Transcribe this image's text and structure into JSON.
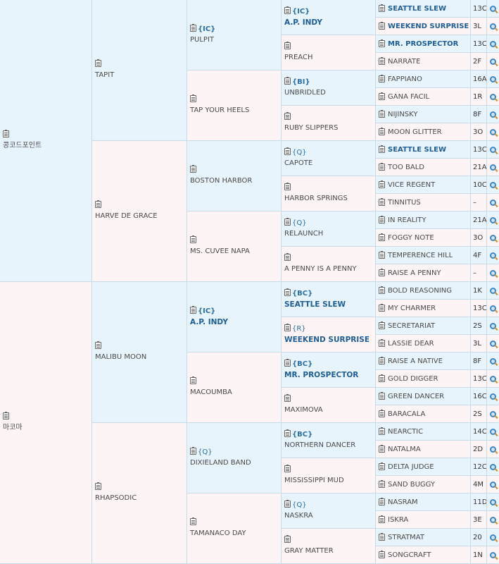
{
  "gen1": [
    {
      "name": "콩코드포인트",
      "tag": "",
      "bold": false
    },
    {
      "name": "마코마",
      "tag": "",
      "bold": false
    }
  ],
  "gen2": [
    {
      "name": "TAPIT",
      "tag": "",
      "bold": false
    },
    {
      "name": "HARVE DE GRACE",
      "tag": "",
      "bold": false
    },
    {
      "name": "MALIBU MOON",
      "tag": "",
      "bold": false
    },
    {
      "name": "RHAPSODIC",
      "tag": "",
      "bold": false
    }
  ],
  "gen3": [
    {
      "name": "PULPIT",
      "tag": "{IC}",
      "bold": false
    },
    {
      "name": "TAP YOUR HEELS",
      "tag": "",
      "bold": false
    },
    {
      "name": "BOSTON HARBOR",
      "tag": "",
      "bold": false
    },
    {
      "name": "MS. CUVEE NAPA",
      "tag": "",
      "bold": false
    },
    {
      "name": "A.P. INDY",
      "tag": "{IC}",
      "bold": true
    },
    {
      "name": "MACOUMBA",
      "tag": "",
      "bold": false
    },
    {
      "name": "DIXIELAND BAND",
      "tag": "{Q}",
      "bold": false
    },
    {
      "name": "TAMANACO DAY",
      "tag": "",
      "bold": false
    }
  ],
  "gen4": [
    {
      "name": "A.P. INDY",
      "tag": "{IC}",
      "bold": true
    },
    {
      "name": "PREACH",
      "tag": "",
      "bold": false
    },
    {
      "name": "UNBRIDLED",
      "tag": "{BI}",
      "bold": false
    },
    {
      "name": "RUBY SLIPPERS",
      "tag": "",
      "bold": false
    },
    {
      "name": "CAPOTE",
      "tag": "{Q}",
      "bold": false
    },
    {
      "name": "HARBOR SPRINGS",
      "tag": "",
      "bold": false
    },
    {
      "name": "RELAUNCH",
      "tag": "{Q}",
      "bold": false
    },
    {
      "name": "A PENNY IS A PENNY",
      "tag": "",
      "bold": false
    },
    {
      "name": "SEATTLE SLEW",
      "tag": "{BC}",
      "bold": true
    },
    {
      "name": "WEEKEND SURPRISE",
      "tag": "{R}",
      "bold": true
    },
    {
      "name": "MR. PROSPECTOR",
      "tag": "{BC}",
      "bold": true
    },
    {
      "name": "MAXIMOVA",
      "tag": "",
      "bold": false
    },
    {
      "name": "NORTHERN DANCER",
      "tag": "{BC}",
      "bold": false
    },
    {
      "name": "MISSISSIPPI MUD",
      "tag": "",
      "bold": false
    },
    {
      "name": "NASKRA",
      "tag": "{Q}",
      "bold": false
    },
    {
      "name": "GRAY MATTER",
      "tag": "",
      "bold": false
    }
  ],
  "gen5": [
    {
      "name": "SEATTLE SLEW",
      "bold": true,
      "code": "13C"
    },
    {
      "name": "WEEKEND SURPRISE",
      "bold": true,
      "code": "3L"
    },
    {
      "name": "MR. PROSPECTOR",
      "bold": true,
      "code": "13C"
    },
    {
      "name": "NARRATE",
      "bold": false,
      "code": "2F"
    },
    {
      "name": "FAPPIANO",
      "bold": false,
      "code": "16A"
    },
    {
      "name": "GANA FACIL",
      "bold": false,
      "code": "1R"
    },
    {
      "name": "NIJINSKY",
      "bold": false,
      "code": "8F"
    },
    {
      "name": "MOON GLITTER",
      "bold": false,
      "code": "3O"
    },
    {
      "name": "SEATTLE SLEW",
      "bold": true,
      "code": "13C"
    },
    {
      "name": "TOO BALD",
      "bold": false,
      "code": "21A"
    },
    {
      "name": "VICE REGENT",
      "bold": false,
      "code": "10C"
    },
    {
      "name": "TINNITUS",
      "bold": false,
      "code": "–"
    },
    {
      "name": "IN REALITY",
      "bold": false,
      "code": "21A"
    },
    {
      "name": "FOGGY NOTE",
      "bold": false,
      "code": "3O"
    },
    {
      "name": "TEMPERENCE HILL",
      "bold": false,
      "code": "4F"
    },
    {
      "name": "RAISE A PENNY",
      "bold": false,
      "code": "–"
    },
    {
      "name": "BOLD REASONING",
      "bold": false,
      "code": "1K"
    },
    {
      "name": "MY CHARMER",
      "bold": false,
      "code": "13C"
    },
    {
      "name": "SECRETARIAT",
      "bold": false,
      "code": "2S"
    },
    {
      "name": "LASSIE DEAR",
      "bold": false,
      "code": "3L"
    },
    {
      "name": "RAISE A NATIVE",
      "bold": false,
      "code": "8F"
    },
    {
      "name": "GOLD DIGGER",
      "bold": false,
      "code": "13C"
    },
    {
      "name": "GREEN DANCER",
      "bold": false,
      "code": "16C"
    },
    {
      "name": "BARACALA",
      "bold": false,
      "code": "2S"
    },
    {
      "name": "NEARCTIC",
      "bold": false,
      "code": "14C"
    },
    {
      "name": "NATALMA",
      "bold": false,
      "code": "2D"
    },
    {
      "name": "DELTA JUDGE",
      "bold": false,
      "code": "12C"
    },
    {
      "name": "SAND BUGGY",
      "bold": false,
      "code": "4M"
    },
    {
      "name": "NASRAM",
      "bold": false,
      "code": "11D"
    },
    {
      "name": "ISKRA",
      "bold": false,
      "code": "3E"
    },
    {
      "name": "STRATMAT",
      "bold": false,
      "code": "20"
    },
    {
      "name": "SONGCRAFT",
      "bold": false,
      "code": "1N"
    }
  ]
}
